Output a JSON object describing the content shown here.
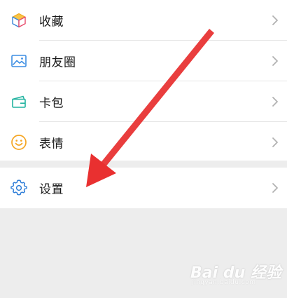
{
  "menu_group_1": {
    "items": [
      {
        "label": "收藏",
        "icon": "favorites-cube-icon"
      },
      {
        "label": "朋友圈",
        "icon": "moments-image-icon"
      },
      {
        "label": "卡包",
        "icon": "card-wallet-icon"
      },
      {
        "label": "表情",
        "icon": "sticker-smiley-icon"
      }
    ]
  },
  "menu_group_2": {
    "items": [
      {
        "label": "设置",
        "icon": "settings-gear-icon"
      }
    ]
  },
  "annotation": {
    "color": "#ee2c2c"
  },
  "watermark": {
    "brand": "Bai du 经验",
    "url": "jingyan.baidu.com"
  },
  "colors": {
    "background": "#ededed",
    "row_background": "#ffffff",
    "text": "#191919",
    "chevron": "#b2b2b2",
    "gear_blue": "#2f7ed8"
  }
}
